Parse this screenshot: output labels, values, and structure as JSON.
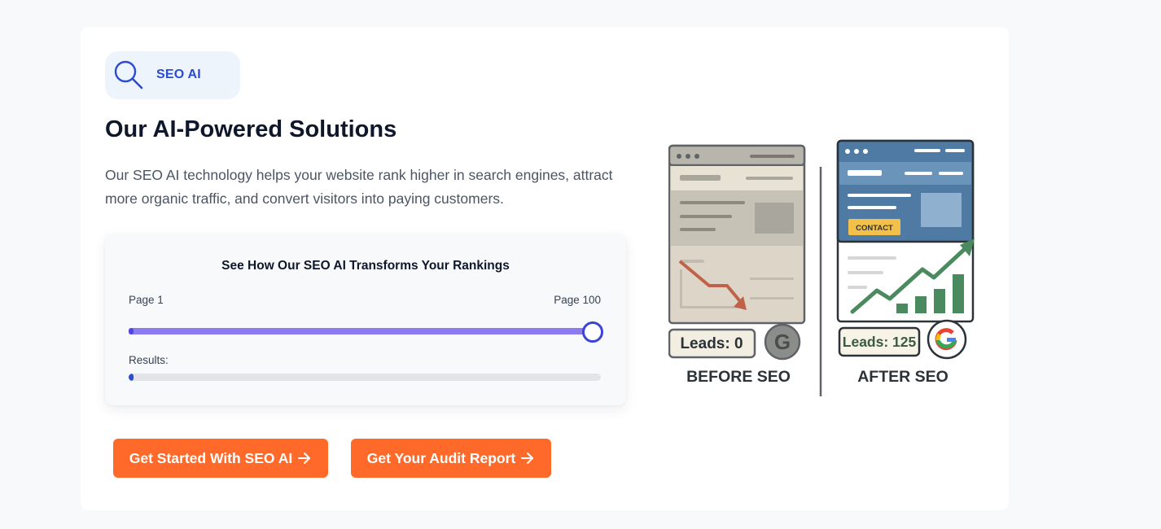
{
  "badge": {
    "label": "SEO AI",
    "icon": "search-icon"
  },
  "heading": "Our AI-Powered Solutions",
  "description": "Our SEO AI technology helps your website rank higher in search engines, attract more organic traffic, and convert visitors into paying customers.",
  "rank_panel": {
    "title": "See How Our SEO AI Transforms Your Rankings",
    "slider_min_label": "Page 1",
    "slider_max_label": "Page 100",
    "slider_value_fraction": 1.0,
    "results_label": "Results:",
    "results_fraction": 0.01
  },
  "buttons": {
    "get_started": "Get Started With SEO AI",
    "audit": "Get Your Audit Report"
  },
  "illustration": {
    "before": {
      "leads": "Leads: 0",
      "caption": "BEFORE SEO"
    },
    "after": {
      "leads": "Leads: 125",
      "caption": "AFTER SEO",
      "cta": "CONTACT"
    }
  },
  "colors": {
    "accent_orange": "#ff6a2b",
    "accent_blue": "#2b4bd3",
    "slider_purple": "#8b7cf2",
    "growth_green": "#4a8a5e",
    "decline_red": "#c0624a"
  }
}
